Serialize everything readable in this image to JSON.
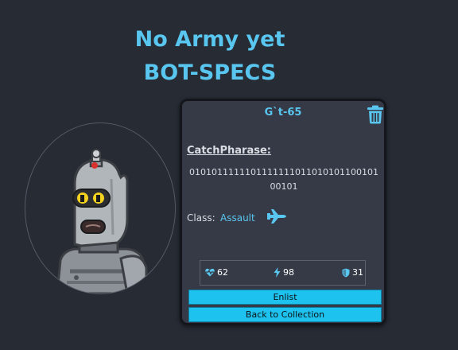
{
  "page": {
    "army_status": "No Army yet",
    "title": "BOT-SPECS"
  },
  "bot": {
    "name": "G`t-65",
    "catchphrase_label": "CatchPharase:",
    "catchphrase": "010101111110111111101101010110010100101",
    "class_label": "Class:",
    "class_value": "Assault",
    "class_icon": "fighter-jet-icon",
    "avatar_icon": "robot-avatar",
    "stats": {
      "health": "62",
      "damage": "98",
      "armor": "31"
    }
  },
  "buttons": {
    "enlist": "Enlist",
    "back": "Back to Collection"
  },
  "colors": {
    "background": "#272b34",
    "accent": "#59c6f0",
    "card": "#353a46",
    "button": "#1ec2ee"
  }
}
